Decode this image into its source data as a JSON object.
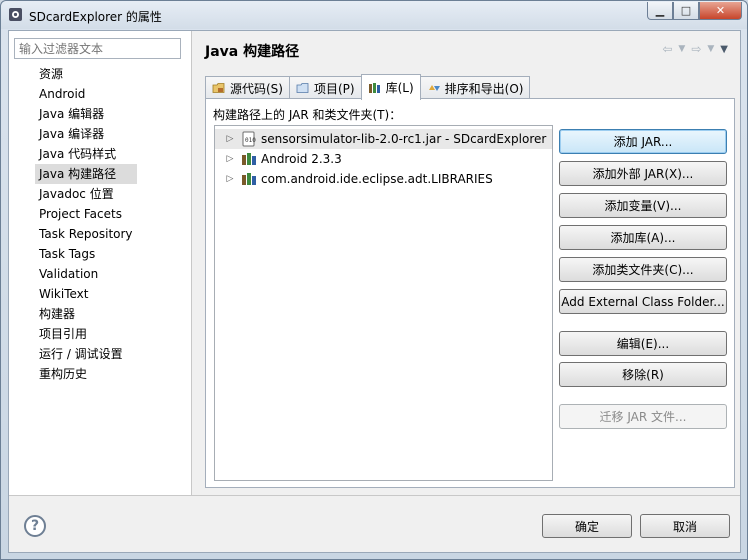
{
  "window": {
    "title": "SDcardExplorer 的属性"
  },
  "sidebar": {
    "filter_placeholder": "输入过滤器文本",
    "items": [
      {
        "label": "资源"
      },
      {
        "label": "Android"
      },
      {
        "label": "Java 编辑器"
      },
      {
        "label": "Java 编译器"
      },
      {
        "label": "Java 代码样式"
      },
      {
        "label": "Java 构建路径",
        "selected": true
      },
      {
        "label": "Javadoc 位置"
      },
      {
        "label": "Project Facets"
      },
      {
        "label": "Task Repository"
      },
      {
        "label": "Task Tags"
      },
      {
        "label": "Validation"
      },
      {
        "label": "WikiText"
      },
      {
        "label": "构建器"
      },
      {
        "label": "项目引用"
      },
      {
        "label": "运行 / 调试设置"
      },
      {
        "label": "重构历史"
      }
    ]
  },
  "main": {
    "title": "Java 构建路径",
    "tabs": [
      {
        "label": "源代码(S)",
        "icon": "source-folder-icon"
      },
      {
        "label": "项目(P)",
        "icon": "project-icon"
      },
      {
        "label": "库(L)",
        "icon": "library-icon",
        "active": true
      },
      {
        "label": "排序和导出(O)",
        "icon": "order-export-icon"
      }
    ],
    "panel_label": "构建路径上的 JAR 和类文件夹(T)：",
    "entries": [
      {
        "label": "sensorsimulator-lib-2.0-rc1.jar  -  SDcardExplorer",
        "icon": "jar-icon",
        "selected": true
      },
      {
        "label": "Android 2.3.3",
        "icon": "library-icon"
      },
      {
        "label": "com.android.ide.eclipse.adt.LIBRARIES",
        "icon": "library-icon"
      }
    ],
    "buttons": {
      "add_jar": "添加 JAR...",
      "add_external_jar": "添加外部 JAR(X)...",
      "add_variable": "添加变量(V)...",
      "add_library": "添加库(A)...",
      "add_class_folder": "添加类文件夹(C)...",
      "add_external_class_folder": "Add External Class Folder...",
      "edit": "编辑(E)...",
      "remove": "移除(R)",
      "migrate_jar": "迁移 JAR 文件..."
    }
  },
  "footer": {
    "ok": "确定",
    "cancel": "取消"
  },
  "colors": {
    "selection": "#dcdcdc",
    "default_button_border": "#3c7fb1",
    "close_button": "#c7452b"
  }
}
